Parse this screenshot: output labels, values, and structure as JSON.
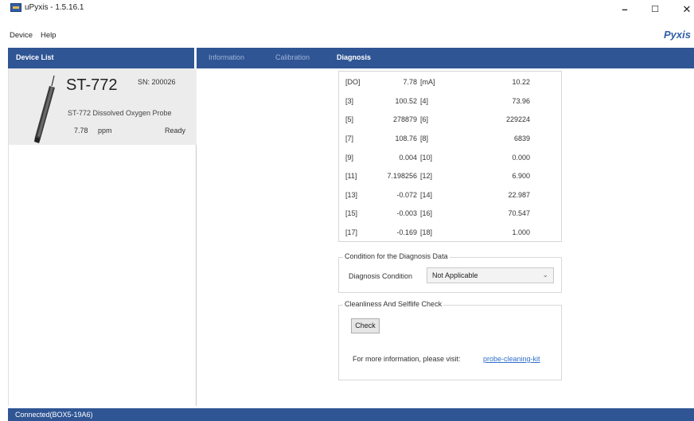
{
  "window": {
    "title": "uPyxis - 1.5.16.1"
  },
  "menu": {
    "device": "Device",
    "help": "Help"
  },
  "brand": "Pyxis",
  "panel": {
    "device_list_title": "Device List"
  },
  "tabs": [
    {
      "label": "Information",
      "active": false
    },
    {
      "label": "Calibration",
      "active": false
    },
    {
      "label": "Diagnosis",
      "active": true
    }
  ],
  "device_card": {
    "model": "ST-772",
    "serial": "SN: 200026",
    "description": "ST-772 Dissolved Oxygen Probe",
    "value": "7.78",
    "unit": "ppm",
    "status": "Ready"
  },
  "diagnosis_rows": [
    {
      "l1": "[DO]",
      "v1": "7.78",
      "l2": "[mA]",
      "v2": "10.22"
    },
    {
      "l1": "[3]",
      "v1": "100.52",
      "l2": "[4]",
      "v2": "73.96"
    },
    {
      "l1": "[5]",
      "v1": "278879",
      "l2": "[6]",
      "v2": "229224"
    },
    {
      "l1": "[7]",
      "v1": "108.76",
      "l2": "[8]",
      "v2": "6839"
    },
    {
      "l1": "[9]",
      "v1": "0.004",
      "l2": "[10]",
      "v2": "0.000"
    },
    {
      "l1": "[11]",
      "v1": "7.198256",
      "l2": "[12]",
      "v2": "6.900"
    },
    {
      "l1": "[13]",
      "v1": "-0.072",
      "l2": "[14]",
      "v2": "22.987"
    },
    {
      "l1": "[15]",
      "v1": "-0.003",
      "l2": "[16]",
      "v2": "70.547"
    },
    {
      "l1": "[17]",
      "v1": "-0.169",
      "l2": "[18]",
      "v2": "1.000"
    }
  ],
  "condition": {
    "group_title": "Condition for the Diagnosis Data",
    "label": "Diagnosis Condition",
    "selected": "Not Applicable"
  },
  "cleanliness": {
    "group_title": "Cleanliness And Selflife Check",
    "check_button": "Check",
    "info_text": "For more information, please visit:",
    "link_text": "probe-cleaning-kit"
  },
  "status_bar": {
    "text": "Connected(BOX5-19A6)"
  },
  "colors": {
    "band": "#2f5594",
    "link": "#2f6fc9",
    "card_bg": "#ececec"
  }
}
